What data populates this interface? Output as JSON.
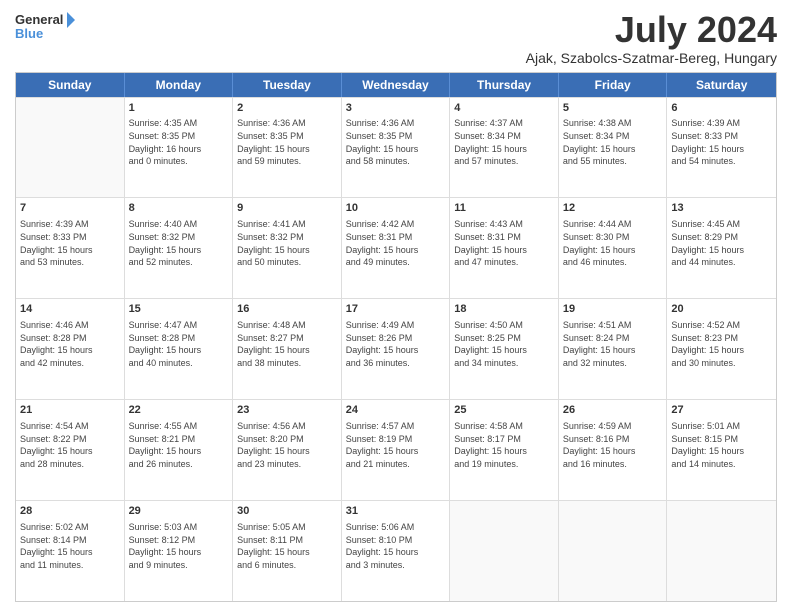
{
  "logo": {
    "line1": "General",
    "line2": "Blue"
  },
  "title": "July 2024",
  "subtitle": "Ajak, Szabolcs-Szatmar-Bereg, Hungary",
  "header_days": [
    "Sunday",
    "Monday",
    "Tuesday",
    "Wednesday",
    "Thursday",
    "Friday",
    "Saturday"
  ],
  "weeks": [
    [
      {
        "day": "",
        "empty": true,
        "info": ""
      },
      {
        "day": "1",
        "info": "Sunrise: 4:35 AM\nSunset: 8:35 PM\nDaylight: 16 hours\nand 0 minutes."
      },
      {
        "day": "2",
        "info": "Sunrise: 4:36 AM\nSunset: 8:35 PM\nDaylight: 15 hours\nand 59 minutes."
      },
      {
        "day": "3",
        "info": "Sunrise: 4:36 AM\nSunset: 8:35 PM\nDaylight: 15 hours\nand 58 minutes."
      },
      {
        "day": "4",
        "info": "Sunrise: 4:37 AM\nSunset: 8:34 PM\nDaylight: 15 hours\nand 57 minutes."
      },
      {
        "day": "5",
        "info": "Sunrise: 4:38 AM\nSunset: 8:34 PM\nDaylight: 15 hours\nand 55 minutes."
      },
      {
        "day": "6",
        "info": "Sunrise: 4:39 AM\nSunset: 8:33 PM\nDaylight: 15 hours\nand 54 minutes."
      }
    ],
    [
      {
        "day": "7",
        "info": "Sunrise: 4:39 AM\nSunset: 8:33 PM\nDaylight: 15 hours\nand 53 minutes."
      },
      {
        "day": "8",
        "info": "Sunrise: 4:40 AM\nSunset: 8:32 PM\nDaylight: 15 hours\nand 52 minutes."
      },
      {
        "day": "9",
        "info": "Sunrise: 4:41 AM\nSunset: 8:32 PM\nDaylight: 15 hours\nand 50 minutes."
      },
      {
        "day": "10",
        "info": "Sunrise: 4:42 AM\nSunset: 8:31 PM\nDaylight: 15 hours\nand 49 minutes."
      },
      {
        "day": "11",
        "info": "Sunrise: 4:43 AM\nSunset: 8:31 PM\nDaylight: 15 hours\nand 47 minutes."
      },
      {
        "day": "12",
        "info": "Sunrise: 4:44 AM\nSunset: 8:30 PM\nDaylight: 15 hours\nand 46 minutes."
      },
      {
        "day": "13",
        "info": "Sunrise: 4:45 AM\nSunset: 8:29 PM\nDaylight: 15 hours\nand 44 minutes."
      }
    ],
    [
      {
        "day": "14",
        "info": "Sunrise: 4:46 AM\nSunset: 8:28 PM\nDaylight: 15 hours\nand 42 minutes."
      },
      {
        "day": "15",
        "info": "Sunrise: 4:47 AM\nSunset: 8:28 PM\nDaylight: 15 hours\nand 40 minutes."
      },
      {
        "day": "16",
        "info": "Sunrise: 4:48 AM\nSunset: 8:27 PM\nDaylight: 15 hours\nand 38 minutes."
      },
      {
        "day": "17",
        "info": "Sunrise: 4:49 AM\nSunset: 8:26 PM\nDaylight: 15 hours\nand 36 minutes."
      },
      {
        "day": "18",
        "info": "Sunrise: 4:50 AM\nSunset: 8:25 PM\nDaylight: 15 hours\nand 34 minutes."
      },
      {
        "day": "19",
        "info": "Sunrise: 4:51 AM\nSunset: 8:24 PM\nDaylight: 15 hours\nand 32 minutes."
      },
      {
        "day": "20",
        "info": "Sunrise: 4:52 AM\nSunset: 8:23 PM\nDaylight: 15 hours\nand 30 minutes."
      }
    ],
    [
      {
        "day": "21",
        "info": "Sunrise: 4:54 AM\nSunset: 8:22 PM\nDaylight: 15 hours\nand 28 minutes."
      },
      {
        "day": "22",
        "info": "Sunrise: 4:55 AM\nSunset: 8:21 PM\nDaylight: 15 hours\nand 26 minutes."
      },
      {
        "day": "23",
        "info": "Sunrise: 4:56 AM\nSunset: 8:20 PM\nDaylight: 15 hours\nand 23 minutes."
      },
      {
        "day": "24",
        "info": "Sunrise: 4:57 AM\nSunset: 8:19 PM\nDaylight: 15 hours\nand 21 minutes."
      },
      {
        "day": "25",
        "info": "Sunrise: 4:58 AM\nSunset: 8:17 PM\nDaylight: 15 hours\nand 19 minutes."
      },
      {
        "day": "26",
        "info": "Sunrise: 4:59 AM\nSunset: 8:16 PM\nDaylight: 15 hours\nand 16 minutes."
      },
      {
        "day": "27",
        "info": "Sunrise: 5:01 AM\nSunset: 8:15 PM\nDaylight: 15 hours\nand 14 minutes."
      }
    ],
    [
      {
        "day": "28",
        "info": "Sunrise: 5:02 AM\nSunset: 8:14 PM\nDaylight: 15 hours\nand 11 minutes."
      },
      {
        "day": "29",
        "info": "Sunrise: 5:03 AM\nSunset: 8:12 PM\nDaylight: 15 hours\nand 9 minutes."
      },
      {
        "day": "30",
        "info": "Sunrise: 5:05 AM\nSunset: 8:11 PM\nDaylight: 15 hours\nand 6 minutes."
      },
      {
        "day": "31",
        "info": "Sunrise: 5:06 AM\nSunset: 8:10 PM\nDaylight: 15 hours\nand 3 minutes."
      },
      {
        "day": "",
        "empty": true,
        "info": ""
      },
      {
        "day": "",
        "empty": true,
        "info": ""
      },
      {
        "day": "",
        "empty": true,
        "info": ""
      }
    ]
  ]
}
